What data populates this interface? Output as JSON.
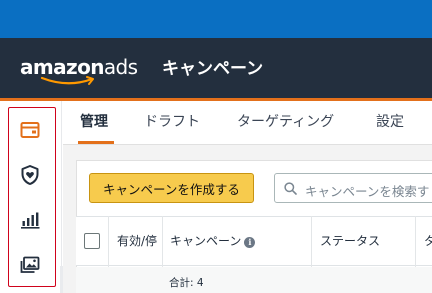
{
  "header": {
    "logo_text_bold": "amazon",
    "logo_text_light": "ads",
    "page_title": "キャンペーン"
  },
  "sidebar": {
    "items": [
      {
        "icon": "campaign-manager-icon"
      },
      {
        "icon": "brand-shield-icon"
      },
      {
        "icon": "reports-icon"
      },
      {
        "icon": "creative-assets-icon"
      }
    ],
    "expand_glyph": "»"
  },
  "tabs": [
    {
      "label": "管理",
      "active": true
    },
    {
      "label": "ドラフト",
      "active": false
    },
    {
      "label": "ターゲティング",
      "active": false
    },
    {
      "label": "設定",
      "active": false
    }
  ],
  "toolbar": {
    "create_button_label": "キャンペーンを作成する",
    "search_placeholder": "キャンペーンを検索す"
  },
  "table": {
    "columns": [
      "有効/停",
      "キャンペーン",
      "ステータス",
      "タ"
    ],
    "info_glyph": "i",
    "total_label": "合計: 4"
  },
  "colors": {
    "header_bg": "#232f3e",
    "top_bar": "#0a6fc2",
    "accent_orange": "#e3701b",
    "button_yellow": "#f7cb4d",
    "highlight_red": "#d0021b"
  }
}
